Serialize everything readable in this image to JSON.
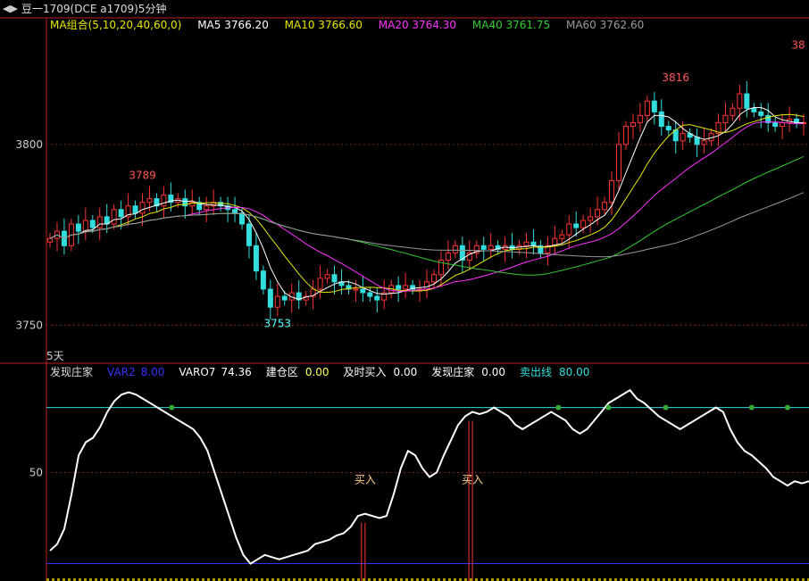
{
  "header": {
    "arrows": "◀▶",
    "title": "豆一1709(DCE a1709)5分钟"
  },
  "ma_legend": {
    "group": {
      "text": "MA组合(5,10,20,40,60,0)",
      "color": "#e6e600"
    },
    "ma5": {
      "text": "MA5 3766.20",
      "color": "#ffffff"
    },
    "ma10": {
      "text": "MA10 3766.60",
      "color": "#e6e600"
    },
    "ma20": {
      "text": "MA20 3764.30",
      "color": "#ff33ff"
    },
    "ma40": {
      "text": "MA40 3761.75",
      "color": "#33cc33"
    },
    "ma60": {
      "text": "MA60 3762.60",
      "color": "#999999"
    }
  },
  "period_label": "5天",
  "indicator_legend": {
    "i1": {
      "text": "发现庄家",
      "color": "#dddddd"
    },
    "i2": {
      "text": "VAR2",
      "color": "#3333ff"
    },
    "i3": {
      "text": "8.00",
      "color": "#3333ff"
    },
    "i4": {
      "text": "VARO7",
      "color": "#ffffff"
    },
    "i5": {
      "text": "74.36",
      "color": "#ffffff"
    },
    "i6": {
      "text": "建仓区",
      "color": "#ffffff"
    },
    "i7": {
      "text": "0.00",
      "color": "#ffff66"
    },
    "i8": {
      "text": "及时买入",
      "color": "#ffffff"
    },
    "i9": {
      "text": "0.00",
      "color": "#ffffff"
    },
    "i10": {
      "text": "发现庄家",
      "color": "#ffffff"
    },
    "i11": {
      "text": "0.00",
      "color": "#ffffff"
    },
    "i12": {
      "text": "卖出线",
      "color": "#33dddd"
    },
    "i13": {
      "text": "80.00",
      "color": "#33dddd"
    }
  },
  "chart_data": [
    {
      "type": "candlestick",
      "y_ticks": [
        "3800",
        "3750"
      ],
      "ylim": [
        3740,
        3835
      ],
      "annotations": [
        {
          "text": "3789",
          "value": 3789,
          "color": "#ff5555"
        },
        {
          "text": "3753",
          "value": 3753,
          "color": "#55ffff"
        },
        {
          "text": "3816",
          "value": 3816,
          "color": "#ff5555"
        },
        {
          "text": "38",
          "value": 3825,
          "color": "#ff5555"
        }
      ],
      "ma_colors": {
        "ma5": "#ffffff",
        "ma10": "#e6e600",
        "ma20": "#ff33ff",
        "ma40": "#33cc33",
        "ma60": "#999999"
      },
      "close": [
        3774,
        3776,
        3772,
        3778,
        3776,
        3779,
        3777,
        3780,
        3778,
        3782,
        3780,
        3783,
        3781,
        3784,
        3785,
        3783,
        3786,
        3784,
        3785,
        3783,
        3784,
        3782,
        3783,
        3784,
        3783,
        3782,
        3781,
        3778,
        3772,
        3765,
        3760,
        3755,
        3758,
        3757,
        3759,
        3757,
        3758,
        3760,
        3763,
        3764,
        3762,
        3761,
        3760,
        3760,
        3759,
        3758,
        3757,
        3759,
        3761,
        3760,
        3761,
        3760,
        3760,
        3762,
        3764,
        3768,
        3770,
        3772,
        3768,
        3770,
        3772,
        3771,
        3772,
        3771,
        3772,
        3771,
        3772,
        3773,
        3772,
        3770,
        3772,
        3774,
        3775,
        3778,
        3777,
        3779,
        3780,
        3782,
        3784,
        3790,
        3800,
        3805,
        3806,
        3808,
        3812,
        3809,
        3805,
        3804,
        3801,
        3803,
        3802,
        3800,
        3801,
        3803,
        3806,
        3808,
        3810,
        3814,
        3810,
        3809,
        3808,
        3806,
        3805,
        3806,
        3807,
        3806,
        3806
      ]
    },
    {
      "type": "line",
      "y_ticks": [
        "50"
      ],
      "ylim": [
        0,
        100
      ],
      "sell_line": 80,
      "var2_line": 8,
      "series": [
        {
          "name": "VARO7",
          "values": [
            14,
            17,
            24,
            40,
            58,
            64,
            66,
            71,
            78,
            83,
            86,
            87,
            86,
            84,
            82,
            80,
            78,
            76,
            74,
            72,
            70,
            66,
            60,
            50,
            40,
            30,
            20,
            12,
            8,
            10,
            12,
            11,
            10,
            11,
            12,
            13,
            14,
            17,
            18,
            19,
            21,
            22,
            25,
            30,
            31,
            30,
            29,
            30,
            40,
            52,
            60,
            58,
            52,
            48,
            50,
            58,
            65,
            72,
            76,
            78,
            77,
            78,
            80,
            78,
            76,
            72,
            70,
            72,
            74,
            76,
            78,
            76,
            74,
            70,
            68,
            70,
            74,
            78,
            82,
            84,
            86,
            88,
            84,
            82,
            79,
            76,
            74,
            72,
            70,
            72,
            74,
            76,
            78,
            80,
            78,
            70,
            64,
            60,
            58,
            55,
            52,
            48,
            46,
            44,
            46,
            45,
            46
          ]
        }
      ],
      "buy_signals": [
        {
          "label": "买入",
          "index": 44
        },
        {
          "label": "买入",
          "index": 59
        }
      ],
      "dots": [
        17,
        71,
        78,
        86,
        98,
        103
      ]
    }
  ]
}
